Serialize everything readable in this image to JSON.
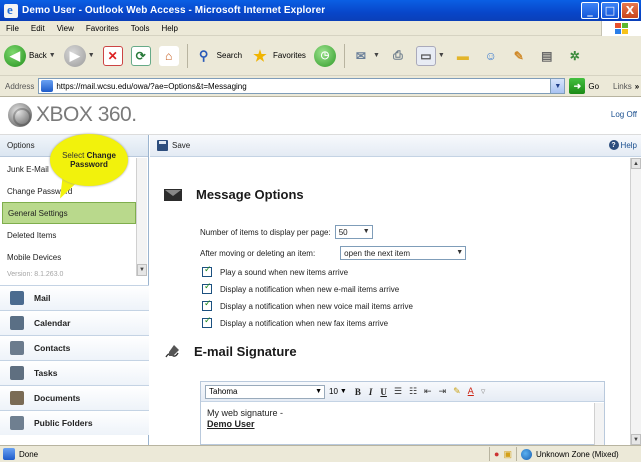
{
  "window": {
    "title": "Demo User - Outlook Web Access - Microsoft Internet Explorer",
    "minimize": "_",
    "maximize": "□",
    "close": "X"
  },
  "menu": [
    "File",
    "Edit",
    "View",
    "Favorites",
    "Tools",
    "Help"
  ],
  "toolbar": {
    "back_label": "Back",
    "search_label": "Search",
    "favorites_label": "Favorites"
  },
  "address": {
    "label": "Address",
    "url": "https://mail.wcsu.edu/owa/?ae=Options&t=Messaging",
    "go_label": "Go",
    "links_label": "Links"
  },
  "header": {
    "logo_text": "XBOX 360.",
    "logoff_label": "Log Off"
  },
  "sidebar": {
    "options_label": "Options",
    "option_items": [
      {
        "label": "Junk E-Mail"
      },
      {
        "label": "Change Password"
      },
      {
        "label": "General Settings"
      },
      {
        "label": "Deleted Items"
      },
      {
        "label": "Mobile Devices"
      }
    ],
    "version": "Version: 8.1.263.0",
    "nav": [
      {
        "label": "Mail",
        "color": "#4b6b8f"
      },
      {
        "label": "Calendar",
        "color": "#5a6f85"
      },
      {
        "label": "Contacts",
        "color": "#6b7b8d"
      },
      {
        "label": "Tasks",
        "color": "#5f6f80"
      },
      {
        "label": "Documents",
        "color": "#7a6b55"
      },
      {
        "label": "Public Folders",
        "color": "#6f7f90"
      }
    ]
  },
  "callout": {
    "line1": "Select",
    "line2": "Change",
    "line3": "Password"
  },
  "main": {
    "save_label": "Save",
    "help_label": "Help",
    "message_options_title": "Message Options",
    "items_per_page_label": "Number of items to display per page:",
    "items_per_page_value": "50",
    "after_move_label": "After moving or deleting an item:",
    "after_move_value": "open the next item",
    "checkboxes": [
      {
        "label": "Play a sound when new items arrive"
      },
      {
        "label": "Display a notification when new e-mail items arrive"
      },
      {
        "label": "Display a notification when new voice mail items arrive"
      },
      {
        "label": "Display a notification when new fax items arrive"
      }
    ],
    "signature_title": "E-mail Signature",
    "font_name": "Tahoma",
    "font_size": "10",
    "bold_label": "B",
    "italic_label": "I",
    "underline_label": "U",
    "signature_line1": "My web signature -",
    "signature_name": "Demo User"
  },
  "status": {
    "left_text": "Done",
    "zone_text": "Unknown Zone (Mixed)"
  }
}
